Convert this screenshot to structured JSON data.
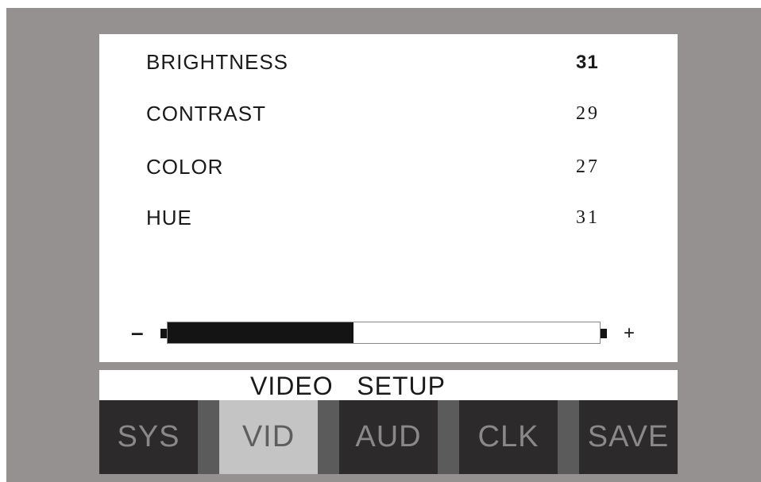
{
  "menu": {
    "items": [
      {
        "label": "BRIGHTNESS",
        "value": "31",
        "selected": true
      },
      {
        "label": "CONTRAST",
        "value": "29",
        "selected": false
      },
      {
        "label": "COLOR",
        "value": "27",
        "selected": false
      },
      {
        "label": "HUE",
        "value": "31",
        "selected": false
      }
    ]
  },
  "slider": {
    "minus_label": "–",
    "plus_label": "+",
    "level_fraction": 0.43
  },
  "section_title": "VIDEO   SETUP",
  "tabs": [
    {
      "label": "SYS",
      "active": false
    },
    {
      "label": "VID",
      "active": true
    },
    {
      "label": "AUD",
      "active": false
    },
    {
      "label": "CLK",
      "active": false
    },
    {
      "label": "SAVE",
      "active": false
    }
  ],
  "colors": {
    "background": "#959190",
    "tab_bg": "#2c2a2a",
    "tab_active_bg": "#c4c4c4",
    "slider_fill": "#141414"
  }
}
